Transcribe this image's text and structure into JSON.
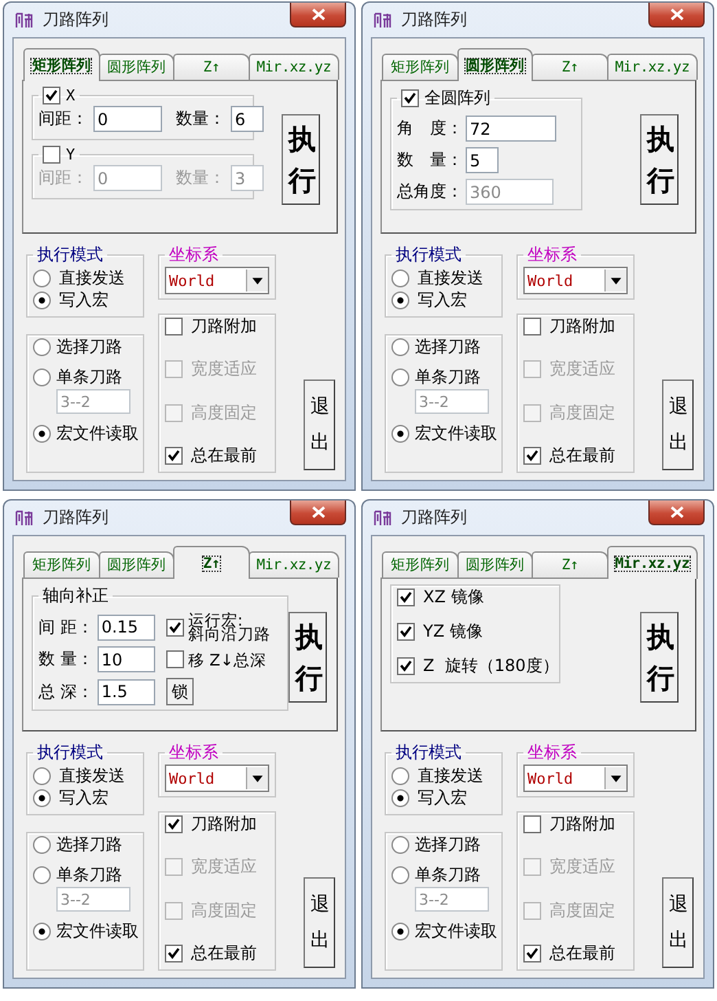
{
  "windows": [
    {
      "title": "刀路阵列",
      "tabs": [
        {
          "label": "矩形阵列",
          "selected": true
        },
        {
          "label": "圆形阵列",
          "selected": false
        },
        {
          "label": "Z↑",
          "selected": false
        },
        {
          "label": "Mir.xz.yz",
          "selected": false
        }
      ],
      "panel": {
        "kind": "rect",
        "groups": [
          {
            "label": "X",
            "checked": true,
            "fields": [
              {
                "label": "间距：",
                "value": "0",
                "disabled": false
              },
              {
                "label": "数量：",
                "value": "6",
                "disabled": false
              }
            ]
          },
          {
            "label": "Y",
            "checked": false,
            "fields": [
              {
                "label": "间距：",
                "value": "0",
                "disabled": true
              },
              {
                "label": "数量：",
                "value": "3",
                "disabled": true
              }
            ]
          }
        ]
      },
      "execute_button": "执行",
      "mode_group": {
        "title": "执行模式",
        "options": [
          {
            "label": "直接发送",
            "selected": false
          },
          {
            "label": "写入宏",
            "selected": true
          }
        ]
      },
      "coord_group": {
        "title": "坐标系",
        "value": "World"
      },
      "path_group": [
        {
          "label": "选择刀路",
          "selected": false
        },
        {
          "label": "单条刀路",
          "selected": false,
          "field": {
            "value": "3--2",
            "disabled": true
          }
        },
        {
          "label": "宏文件读取",
          "selected": true
        }
      ],
      "options": [
        {
          "label": "刀路附加",
          "checked": false,
          "disabled": false
        },
        {
          "label": "宽度适应",
          "checked": false,
          "disabled": true
        },
        {
          "label": "高度固定",
          "checked": false,
          "disabled": true
        },
        {
          "label": "总在最前",
          "checked": true,
          "disabled": false
        }
      ],
      "exit_button": "退出"
    },
    {
      "title": "刀路阵列",
      "tabs": [
        {
          "label": "矩形阵列",
          "selected": false
        },
        {
          "label": "圆形阵列",
          "selected": true
        },
        {
          "label": "Z↑",
          "selected": false
        },
        {
          "label": "Mir.xz.yz",
          "selected": false
        }
      ],
      "panel": {
        "kind": "circle",
        "check": {
          "label": "全圆阵列",
          "checked": true
        },
        "fields": [
          {
            "label": "角　度：",
            "value": "72",
            "disabled": false
          },
          {
            "label": "数　量：",
            "value": "5",
            "disabled": false
          },
          {
            "label": "总角度：",
            "value": "360",
            "disabled": true
          }
        ]
      },
      "execute_button": "执行",
      "mode_group": {
        "title": "执行模式",
        "options": [
          {
            "label": "直接发送",
            "selected": false
          },
          {
            "label": "写入宏",
            "selected": true
          }
        ]
      },
      "coord_group": {
        "title": "坐标系",
        "value": "World"
      },
      "path_group": [
        {
          "label": "选择刀路",
          "selected": false
        },
        {
          "label": "单条刀路",
          "selected": false,
          "field": {
            "value": "3--2",
            "disabled": true
          }
        },
        {
          "label": "宏文件读取",
          "selected": true
        }
      ],
      "options": [
        {
          "label": "刀路附加",
          "checked": false,
          "disabled": false
        },
        {
          "label": "宽度适应",
          "checked": false,
          "disabled": true
        },
        {
          "label": "高度固定",
          "checked": false,
          "disabled": true
        },
        {
          "label": "总在最前",
          "checked": true,
          "disabled": false
        }
      ],
      "exit_button": "退出"
    },
    {
      "title": "刀路阵列",
      "tabs": [
        {
          "label": "矩形阵列",
          "selected": false
        },
        {
          "label": "圆形阵列",
          "selected": false
        },
        {
          "label": "Z↑",
          "selected": true
        },
        {
          "label": "Mir.xz.yz",
          "selected": false
        }
      ],
      "panel": {
        "kind": "axial",
        "title": "轴向补正",
        "rows": [
          {
            "label": "间 距：",
            "value": "0.15",
            "extra": {
              "kind": "check",
              "lines": [
                "运行宏:",
                "斜向沿刀路"
              ],
              "checked": true
            }
          },
          {
            "label": "数 量：",
            "value": "10",
            "extra": {
              "kind": "check",
              "lines": [
                "移 Z↓总深"
              ],
              "checked": false
            }
          },
          {
            "label": "总 深：",
            "value": "1.5",
            "extra": {
              "kind": "button",
              "label": "锁"
            }
          }
        ]
      },
      "execute_button": "执行",
      "mode_group": {
        "title": "执行模式",
        "options": [
          {
            "label": "直接发送",
            "selected": false
          },
          {
            "label": "写入宏",
            "selected": true
          }
        ]
      },
      "coord_group": {
        "title": "坐标系",
        "value": "World"
      },
      "path_group": [
        {
          "label": "选择刀路",
          "selected": false
        },
        {
          "label": "单条刀路",
          "selected": false,
          "field": {
            "value": "3--2",
            "disabled": true
          }
        },
        {
          "label": "宏文件读取",
          "selected": true
        }
      ],
      "options": [
        {
          "label": "刀路附加",
          "checked": true,
          "disabled": false
        },
        {
          "label": "宽度适应",
          "checked": false,
          "disabled": true
        },
        {
          "label": "高度固定",
          "checked": false,
          "disabled": true
        },
        {
          "label": "总在最前",
          "checked": true,
          "disabled": false
        }
      ],
      "exit_button": "退出"
    },
    {
      "title": "刀路阵列",
      "tabs": [
        {
          "label": "矩形阵列",
          "selected": false
        },
        {
          "label": "圆形阵列",
          "selected": false
        },
        {
          "label": "Z↑",
          "selected": false
        },
        {
          "label": "Mir.xz.yz",
          "selected": true
        }
      ],
      "panel": {
        "kind": "mirror",
        "checks": [
          {
            "label": "XZ 镜像",
            "checked": true
          },
          {
            "label": "YZ 镜像",
            "checked": true
          },
          {
            "label": "Z  旋转（180度）",
            "checked": true
          }
        ]
      },
      "execute_button": "执行",
      "mode_group": {
        "title": "执行模式",
        "options": [
          {
            "label": "直接发送",
            "selected": false
          },
          {
            "label": "写入宏",
            "selected": true
          }
        ]
      },
      "coord_group": {
        "title": "坐标系",
        "value": "World"
      },
      "path_group": [
        {
          "label": "选择刀路",
          "selected": false
        },
        {
          "label": "单条刀路",
          "selected": false,
          "field": {
            "value": "3--2",
            "disabled": true
          }
        },
        {
          "label": "宏文件读取",
          "selected": true
        }
      ],
      "options": [
        {
          "label": "刀路附加",
          "checked": false,
          "disabled": false
        },
        {
          "label": "宽度适应",
          "checked": false,
          "disabled": true
        },
        {
          "label": "高度固定",
          "checked": false,
          "disabled": true
        },
        {
          "label": "总在最前",
          "checked": true,
          "disabled": false
        }
      ],
      "exit_button": "退出"
    }
  ]
}
